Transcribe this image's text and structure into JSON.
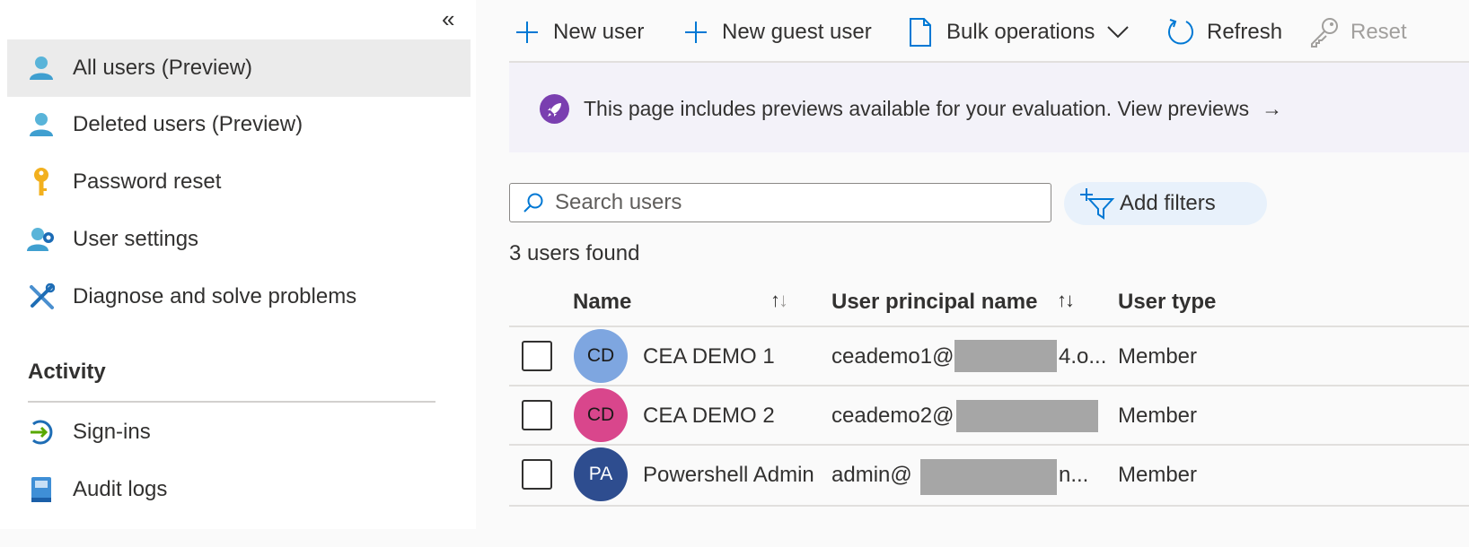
{
  "sidebar": {
    "collapse_glyph": "«",
    "items": [
      {
        "label": "All users (Preview)",
        "icon": "user-icon",
        "active": true
      },
      {
        "label": "Deleted users (Preview)",
        "icon": "user-icon"
      },
      {
        "label": "Password reset",
        "icon": "key-icon"
      },
      {
        "label": "User settings",
        "icon": "user-settings-icon"
      },
      {
        "label": "Diagnose and solve problems",
        "icon": "wrench-icon"
      }
    ],
    "section_title": "Activity",
    "activity_items": [
      {
        "label": "Sign-ins",
        "icon": "sign-in-icon"
      },
      {
        "label": "Audit logs",
        "icon": "audit-log-icon"
      }
    ]
  },
  "toolbar": {
    "new_user": "New user",
    "new_guest_user": "New guest user",
    "bulk_operations": "Bulk operations",
    "refresh": "Refresh",
    "reset": "Reset"
  },
  "banner": {
    "text": "This page includes previews available for your evaluation. View previews",
    "arrow": "→"
  },
  "search": {
    "placeholder": "Search users",
    "value": ""
  },
  "filters": {
    "label": "Add filters"
  },
  "result_count": "3 users found",
  "table": {
    "columns": {
      "name": "Name",
      "upn": "User principal name",
      "user_type": "User type"
    },
    "rows": [
      {
        "initials": "CD",
        "name": "CEA DEMO 1",
        "upn_prefix": "ceademo1@",
        "upn_suffix": "4.o...",
        "user_type": "Member"
      },
      {
        "initials": "CD",
        "name": "CEA DEMO 2",
        "upn_prefix": "ceademo2@",
        "upn_suffix": "",
        "user_type": "Member"
      },
      {
        "initials": "PA",
        "name": "Powershell Admin",
        "upn_prefix": "admin@",
        "upn_suffix": "n...",
        "user_type": "Member"
      }
    ]
  },
  "colors": {
    "accent": "#0078d4",
    "avatar_1": "#7ea6e0",
    "avatar_2": "#d9468c",
    "avatar_3": "#2e4d8f",
    "banner_bg": "#f3f2f9",
    "preview_badge": "#7a3fb0",
    "redaction": "#a6a6a6"
  }
}
